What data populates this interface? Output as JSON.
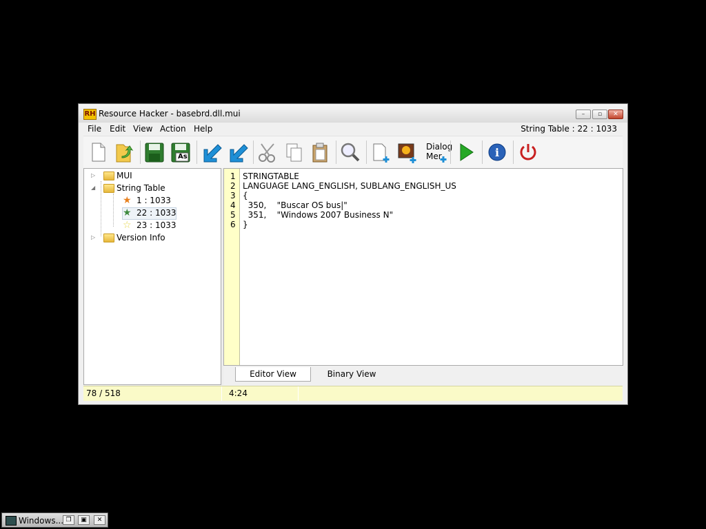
{
  "window": {
    "title": "Resource Hacker - basebrd.dll.mui",
    "app_icon_text": "RH",
    "buttons": {
      "minimize": "–",
      "maximize": "▫",
      "close": "✕"
    }
  },
  "menu": {
    "items": [
      "File",
      "Edit",
      "View",
      "Action",
      "Help"
    ],
    "status": "String Table : 22 : 1033"
  },
  "toolbar": {
    "buttons": [
      "new-icon",
      "open-icon",
      "save-icon",
      "save-as-icon",
      "back-arrow-icon",
      "forward-arrow-icon",
      "cut-icon",
      "copy-icon",
      "paste-icon",
      "search-icon",
      "add-resource-icon",
      "add-image-icon",
      "add-dialog-icon",
      "run-icon",
      "info-icon",
      "power-icon"
    ],
    "save_as_text": "As",
    "dialog_menu_text": [
      "Dialog",
      "Mer"
    ]
  },
  "tree": {
    "items": [
      {
        "label": "MUI"
      },
      {
        "label": "String Table"
      },
      {
        "label": "1 : 1033"
      },
      {
        "label": "22 : 1033"
      },
      {
        "label": "23 : 1033"
      },
      {
        "label": "Version Info"
      }
    ]
  },
  "editor": {
    "line_numbers": [
      "1",
      "2",
      "3",
      "4",
      "5",
      "6"
    ],
    "lines": [
      "STRINGTABLE",
      "LANGUAGE LANG_ENGLISH, SUBLANG_ENGLISH_US",
      "{",
      "  350,    \"Buscar OS bus|\"",
      "  351,    \"Windows 2007 Business N\"",
      "}"
    ]
  },
  "tabs": {
    "editor": "Editor View",
    "binary": "Binary View"
  },
  "status": {
    "left": "78 / 518",
    "pos": "4:24"
  },
  "taskbar": {
    "label": "Windows..."
  }
}
